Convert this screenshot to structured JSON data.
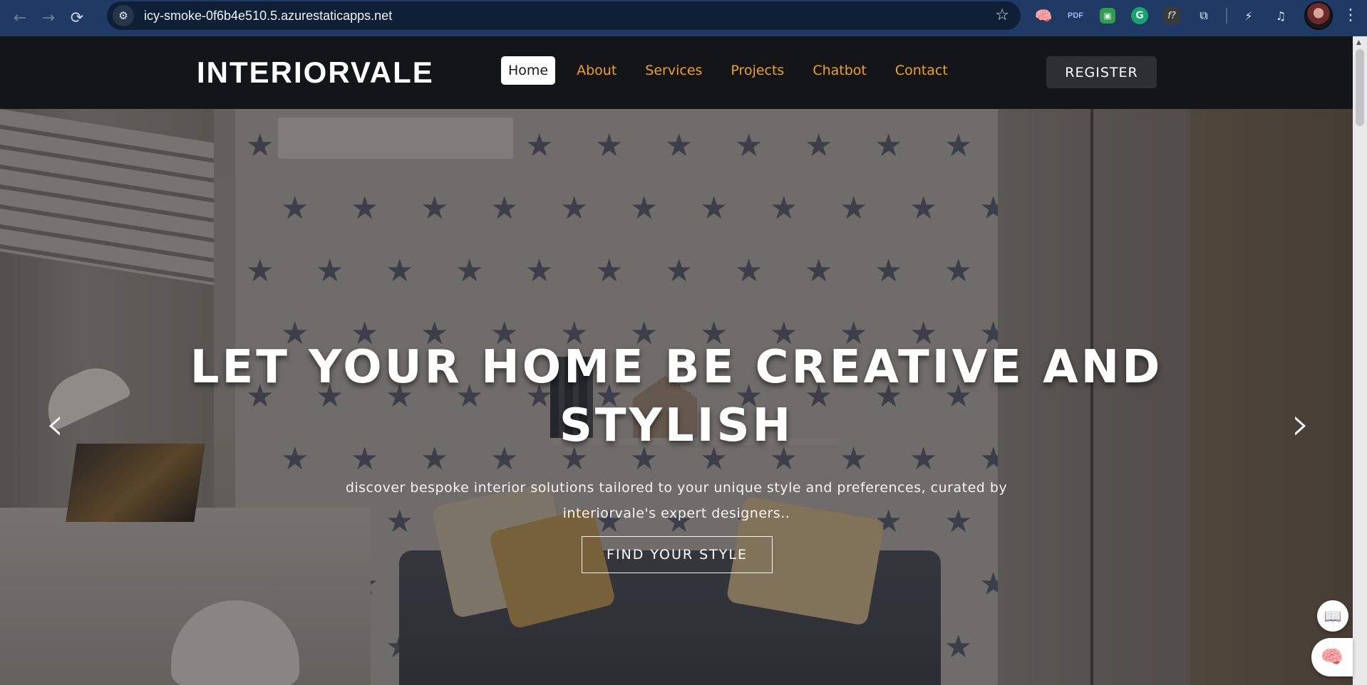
{
  "browser": {
    "url": "icy-smoke-0f6b4e510.5.azurestaticapps.net",
    "back_icon": "←",
    "forward_icon": "→",
    "reload_icon": "⟳",
    "site_info_icon": "⚙",
    "bookmark_icon": "☆",
    "menu_icon": "⋮",
    "extensions": [
      {
        "name": "brain-extension-icon",
        "glyph": "🧠"
      },
      {
        "name": "pdf-extension-icon",
        "glyph": "PDF"
      },
      {
        "name": "green-extension-icon",
        "glyph": "▣"
      },
      {
        "name": "grammarly-icon",
        "glyph": "G"
      },
      {
        "name": "fx-extension-icon",
        "glyph": "f?"
      },
      {
        "name": "extensions-puzzle-icon",
        "glyph": "⧉"
      },
      {
        "name": "performance-icon",
        "glyph": "⚡"
      },
      {
        "name": "media-queue-icon",
        "glyph": "♫"
      }
    ]
  },
  "site": {
    "brand": "INTERIORVALE",
    "nav": [
      {
        "label": "Home",
        "active": true
      },
      {
        "label": "About",
        "active": false
      },
      {
        "label": "Services",
        "active": false
      },
      {
        "label": "Projects",
        "active": false
      },
      {
        "label": "Chatbot",
        "active": false
      },
      {
        "label": "Contact",
        "active": false
      }
    ],
    "register_label": "REGISTER"
  },
  "hero": {
    "title": "LET YOUR HOME BE CREATIVE AND STYLISH",
    "subtitle": "discover bespoke interior solutions tailored to your unique style and preferences, curated by interiorvale's expert designers..",
    "cta_label": "FIND YOUR STYLE",
    "prev_arrow": "‹",
    "next_arrow": "›"
  },
  "widgets": {
    "reader_icon": "📖",
    "ai_icon": "🧠"
  },
  "colors": {
    "chrome_bg": "#1f3a64",
    "header_bg": "#141518",
    "nav_accent": "#f0a21a",
    "star_color": "#3c4458"
  }
}
